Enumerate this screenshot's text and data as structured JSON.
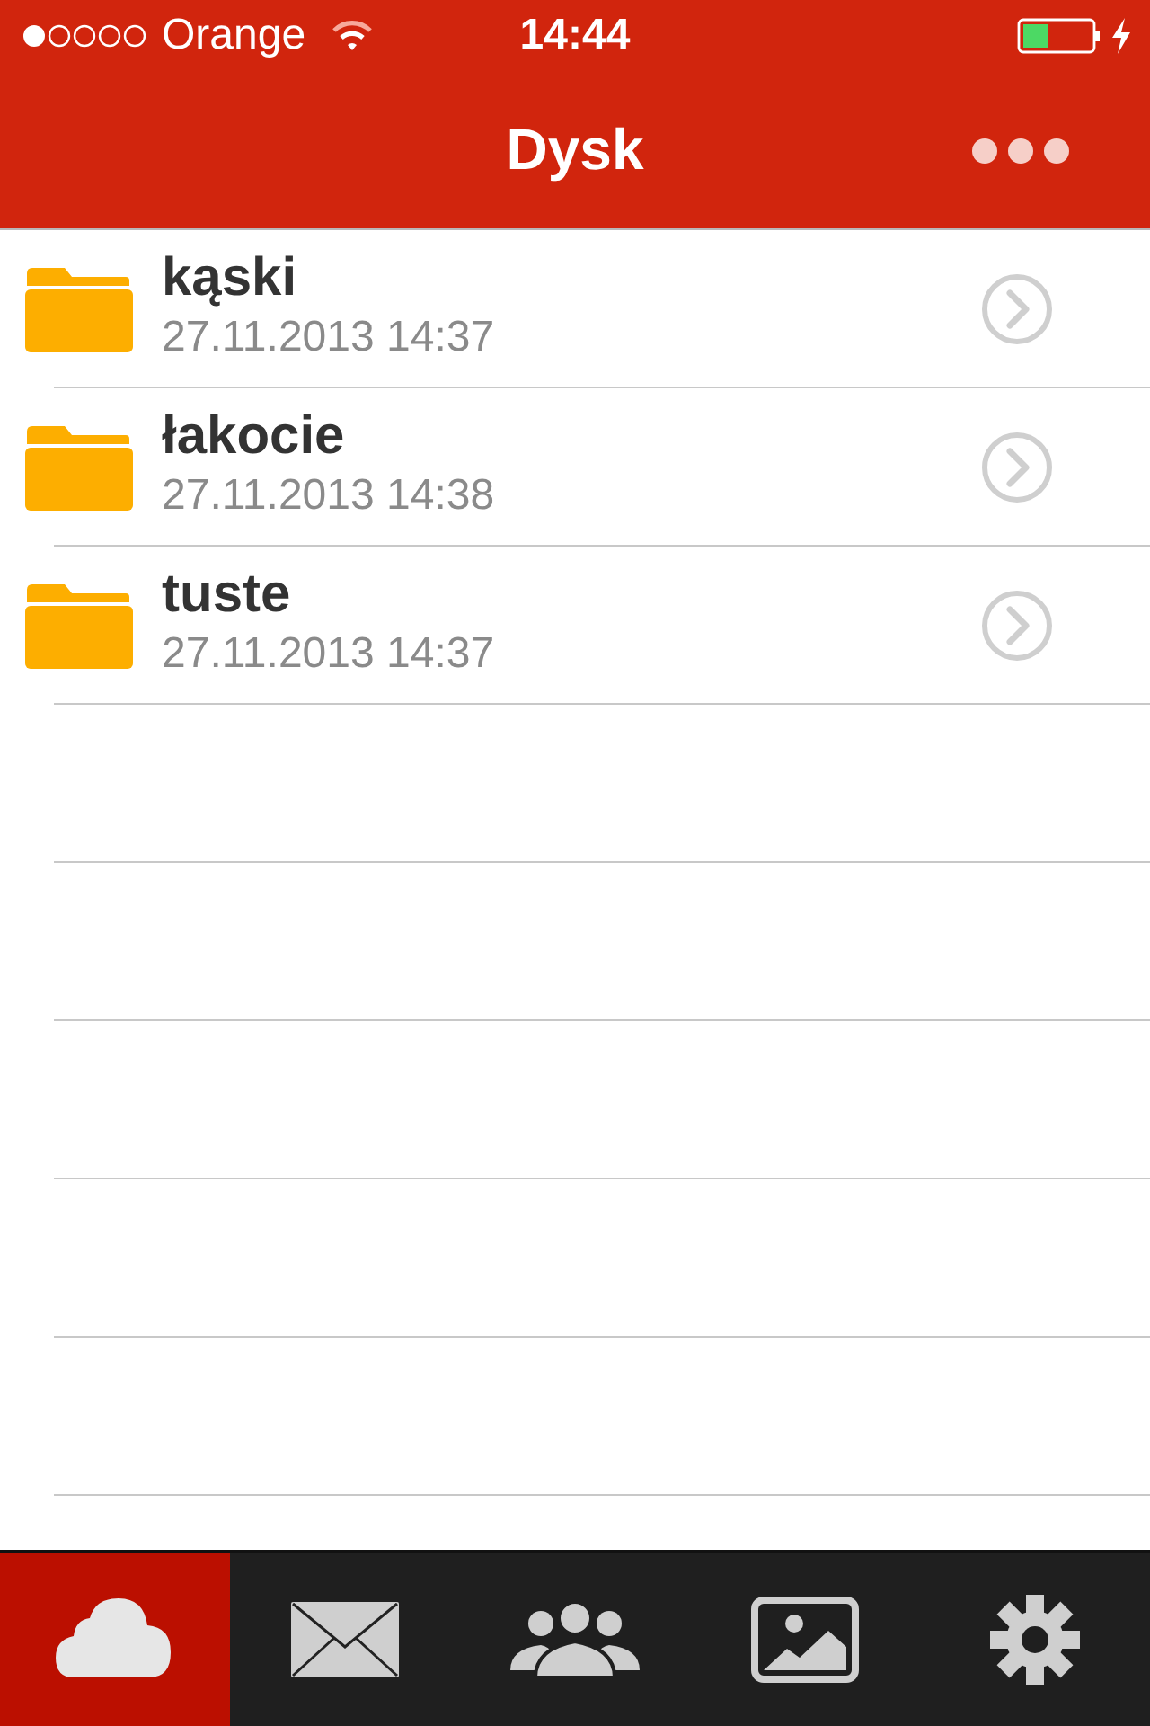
{
  "status_bar": {
    "carrier": "Orange",
    "time": "14:44"
  },
  "nav_bar": {
    "title": "Dysk"
  },
  "folders": [
    {
      "name": "kąski",
      "modified": "27.11.2013 14:37"
    },
    {
      "name": "łakocie",
      "modified": "27.11.2013 14:38"
    },
    {
      "name": "tuste",
      "modified": "27.11.2013 14:37"
    }
  ],
  "tabs": [
    {
      "kind": "cloud",
      "selected": true
    },
    {
      "kind": "mail",
      "selected": false
    },
    {
      "kind": "people",
      "selected": false
    },
    {
      "kind": "photo",
      "selected": false
    },
    {
      "kind": "settings",
      "selected": false
    }
  ]
}
